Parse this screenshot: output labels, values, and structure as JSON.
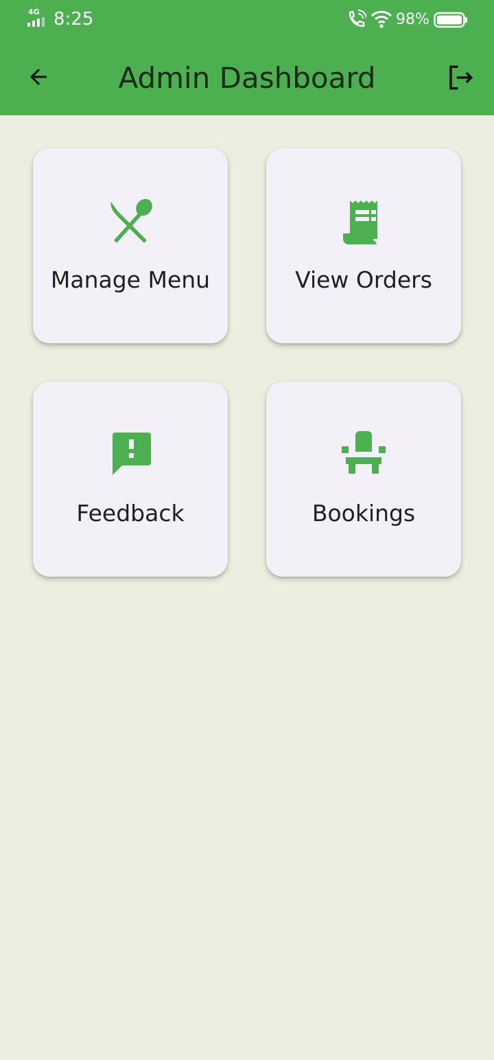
{
  "status_bar": {
    "network": "4G",
    "time": "8:25",
    "battery": "98%"
  },
  "app_bar": {
    "title": "Admin Dashboard",
    "back_icon": "arrow-back-icon",
    "logout_icon": "logout-icon",
    "color": "#4caf50"
  },
  "cards": [
    {
      "label": "Manage Menu",
      "icon": "restaurant-icon"
    },
    {
      "label": "View Orders",
      "icon": "receipt-icon"
    },
    {
      "label": "Feedback",
      "icon": "feedback-icon"
    },
    {
      "label": "Bookings",
      "icon": "chair-icon"
    }
  ],
  "colors": {
    "accent": "#4caf50",
    "background": "#ecefe0",
    "card": "#f3f0f8"
  }
}
